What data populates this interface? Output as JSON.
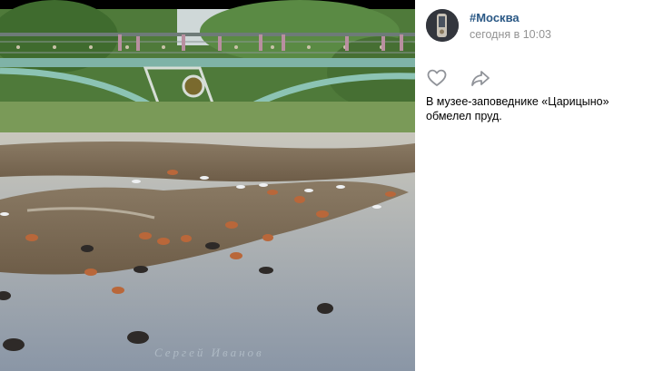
{
  "post": {
    "author": "#Москва",
    "timestamp": "сегодня в 10:03",
    "caption": "В музее-заповеднике «Царицыно» обмелел пруд."
  },
  "photo": {
    "watermark": "Сергей Иванов"
  },
  "icons": {
    "like": "heart-icon",
    "share": "share-arrow-icon"
  },
  "colors": {
    "link": "#2a5885",
    "muted": "#939393",
    "icon": "#909399"
  }
}
